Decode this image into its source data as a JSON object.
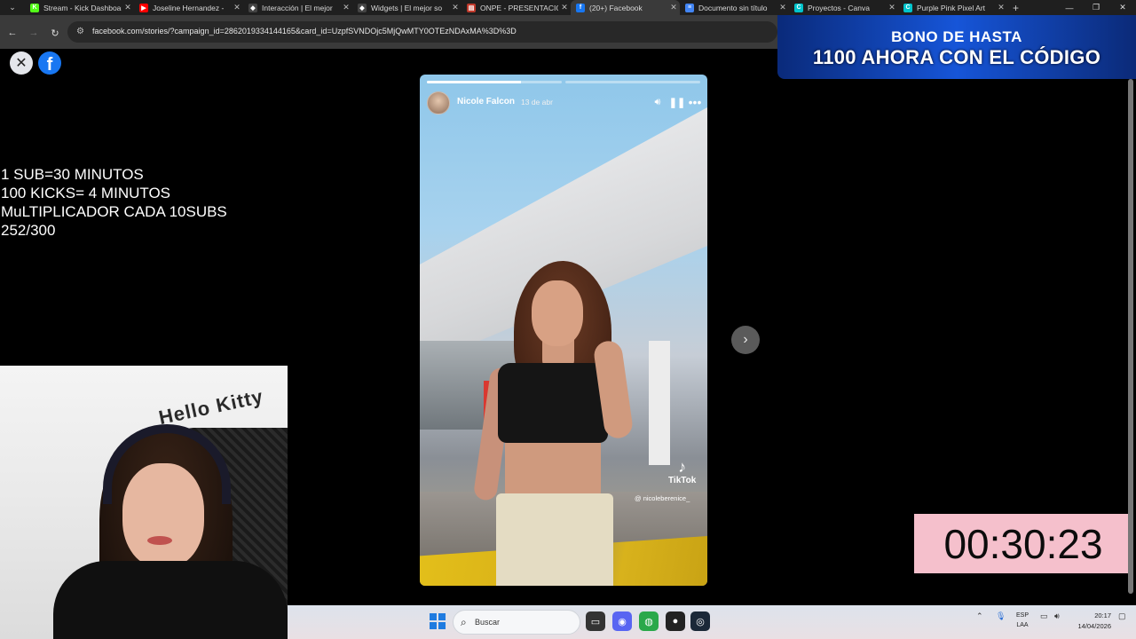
{
  "browser": {
    "tabs": [
      {
        "title": "Stream - Kick Dashboard",
        "favicon_color": "#53fc18",
        "favicon": "K"
      },
      {
        "title": "Joseline Hernandez -",
        "favicon_color": "#ff0000",
        "favicon": "▶"
      },
      {
        "title": "Interacción | El mejor",
        "favicon_color": "#444444",
        "favicon": "◆"
      },
      {
        "title": "Widgets | El mejor so",
        "favicon_color": "#444444",
        "favicon": "◆"
      },
      {
        "title": "ONPE - PRESENTACIÓ",
        "favicon_color": "#c0392b",
        "favicon": "▤"
      },
      {
        "title": "(20+) Facebook",
        "favicon_color": "#1877f2",
        "favicon": "f",
        "active": true
      },
      {
        "title": "Documento sin título",
        "favicon_color": "#4285f4",
        "favicon": "≡"
      },
      {
        "title": "Proyectos - Canva",
        "favicon_color": "#00c4cc",
        "favicon": "C"
      },
      {
        "title": "Purple Pink Pixel Art",
        "favicon_color": "#00c4cc",
        "favicon": "C"
      }
    ],
    "url": "facebook.com/stories/?campaign_id=2862019334144165&card_id=UzpfSVNDOjc5MjQwMTY0OTEzNDAxMA%3D%3D"
  },
  "ad_banner": {
    "line1": "BONO DE HASTA",
    "line2": "1100 AHORA CON EL CÓDIGO"
  },
  "overlay": {
    "lines": [
      "1 SUB=30 MINUTOS",
      "100 KICKS= 4 MINUTOS",
      "MuLTIPLICADOR CADA 10SUBS",
      "252/300"
    ]
  },
  "story": {
    "author": "Nicole Falcon",
    "date": "13 de abr",
    "progress_segments": [
      0.7,
      0.0
    ],
    "tiktok_label": "TikTok",
    "tiktok_user": "@ nicoleberenice_"
  },
  "webcam": {
    "background_text": "Hello Kitty"
  },
  "timer": {
    "value": "00:30:23"
  },
  "taskbar": {
    "search_placeholder": "Buscar",
    "lang_top": "ESP",
    "lang_bottom": "LAA",
    "time": "20:17",
    "date": "14/04/2026"
  },
  "colors": {
    "facebook_blue": "#1877f2",
    "timer_bg": "#f5c0cc",
    "ad_blue": "#1655d8"
  }
}
